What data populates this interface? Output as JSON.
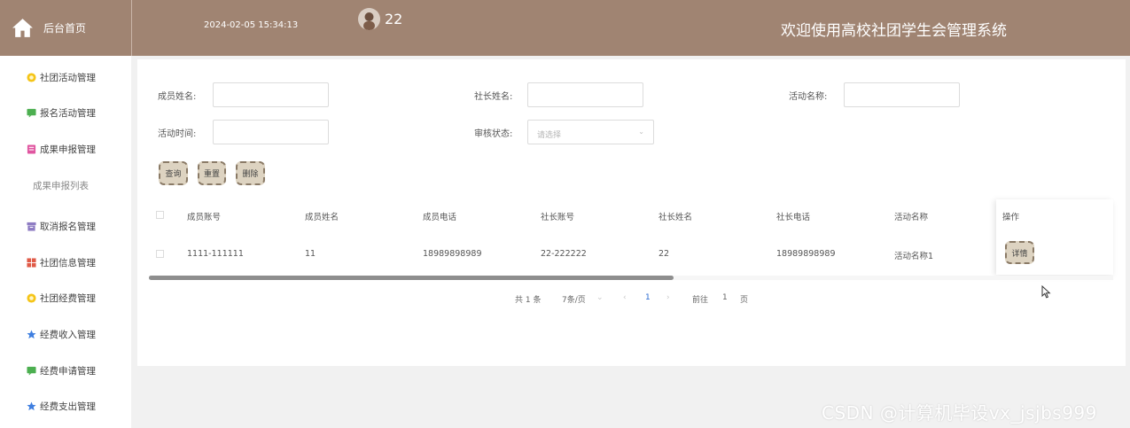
{
  "header": {
    "home_label": "后台首页",
    "datetime": "2024-02-05 15:34:13",
    "username": "22",
    "system_title": "欢迎使用高校社团学生会管理系统"
  },
  "sidebar": {
    "items": [
      {
        "label": "社团活动管理",
        "icon": "star-badge-icon",
        "color": "#f5c518"
      },
      {
        "label": "报名活动管理",
        "icon": "chat-icon",
        "color": "#4caf50"
      },
      {
        "label": "成果申报管理",
        "icon": "document-icon",
        "color": "#e056a0"
      },
      {
        "label": "取消报名管理",
        "icon": "archive-icon",
        "color": "#8e7cc3"
      },
      {
        "label": "社团信息管理",
        "icon": "grid-icon",
        "color": "#e05a47"
      },
      {
        "label": "社团经费管理",
        "icon": "star-badge-icon",
        "color": "#f5c518"
      },
      {
        "label": "经费收入管理",
        "icon": "star-icon",
        "color": "#3f7fe0"
      },
      {
        "label": "经费申请管理",
        "icon": "chat-icon",
        "color": "#4caf50"
      },
      {
        "label": "经费支出管理",
        "icon": "star-icon",
        "color": "#3f7fe0"
      }
    ],
    "active_sub": "成果申报列表"
  },
  "search": {
    "member_name_label": "成员姓名:",
    "president_name_label": "社长姓名:",
    "activity_name_label": "活动名称:",
    "activity_time_label": "活动时间:",
    "review_status_label": "审核状态:",
    "review_status_placeholder": "请选择",
    "query_label": "查询",
    "reset_label": "重置",
    "delete_label": "删除"
  },
  "table": {
    "columns": [
      "成员账号",
      "成员姓名",
      "成员电话",
      "社长账号",
      "社长姓名",
      "社长电话",
      "活动名称",
      "操作"
    ],
    "rows": [
      {
        "cells": [
          "1111-111111",
          "11",
          "18989898989",
          "22-222222",
          "22",
          "18989898989",
          "活动名称1"
        ],
        "action": "详情"
      }
    ]
  },
  "pagination": {
    "total": "共 1 条",
    "page_size": "7条/页",
    "current_page": "1",
    "goto_label": "前往",
    "goto_value": "1",
    "page_unit": "页"
  },
  "watermark": "CSDN @计算机毕设vx_jsjbs999"
}
